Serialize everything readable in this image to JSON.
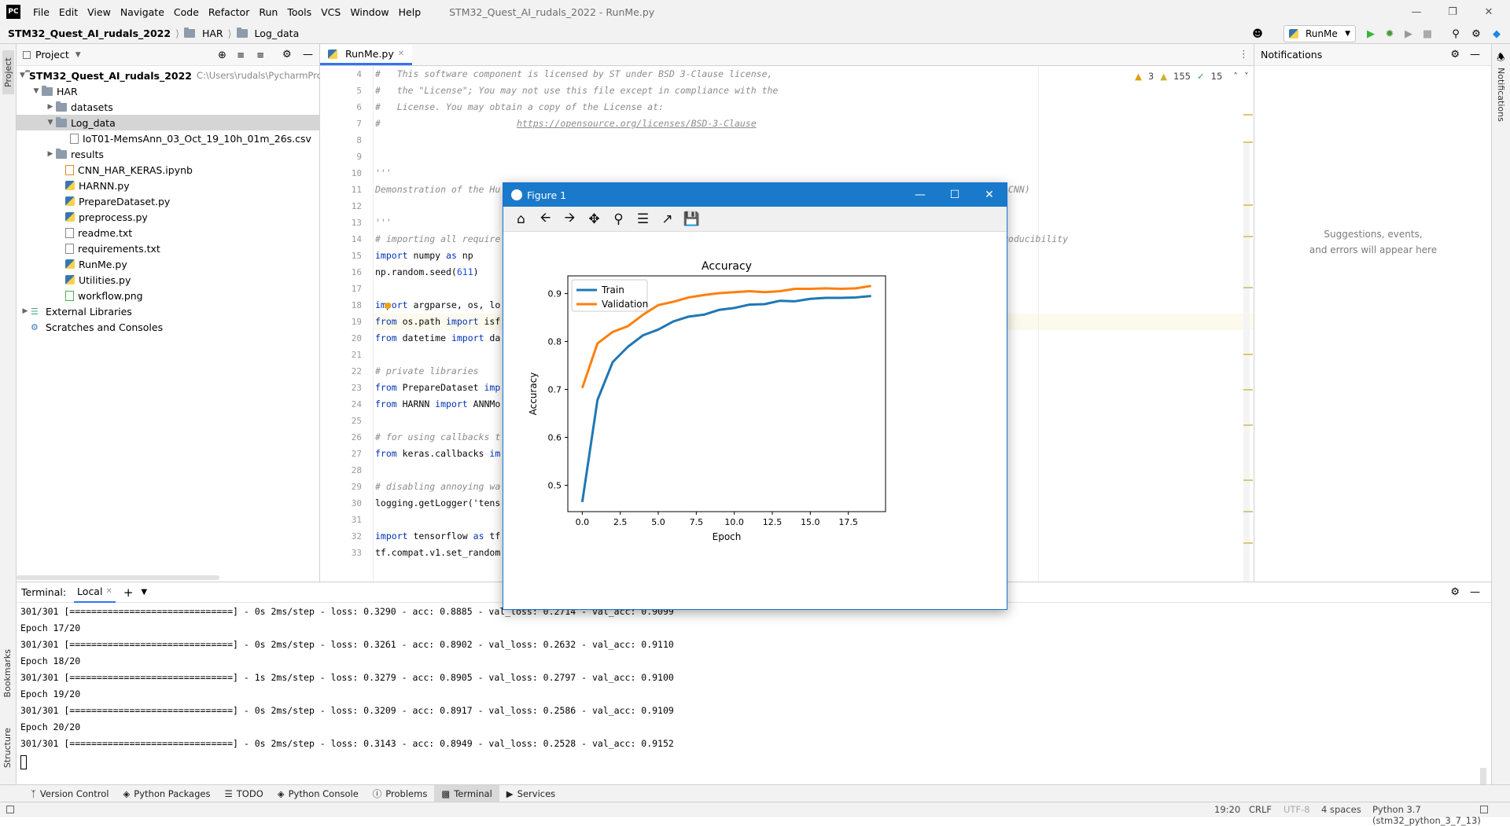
{
  "app": {
    "logo": "PC",
    "menu": [
      "File",
      "Edit",
      "View",
      "Navigate",
      "Code",
      "Refactor",
      "Run",
      "Tools",
      "VCS",
      "Window",
      "Help"
    ],
    "window_title": "STM32_Quest_AI_rudals_2022 - RunMe.py"
  },
  "breadcrumb": [
    "STM32_Quest_AI_rudals_2022",
    "HAR",
    "Log_data"
  ],
  "toolbar": {
    "run_config": "RunMe"
  },
  "project": {
    "header": "Project",
    "root_name": "STM32_Quest_AI_rudals_2022",
    "root_path": "C:\\Users\\rudals\\PycharmProj",
    "items": [
      {
        "label": "HAR"
      },
      {
        "label": "datasets"
      },
      {
        "label": "Log_data"
      },
      {
        "label": "IoT01-MemsAnn_03_Oct_19_10h_01m_26s.csv"
      },
      {
        "label": "results"
      },
      {
        "label": "CNN_HAR_KERAS.ipynb"
      },
      {
        "label": "HARNN.py"
      },
      {
        "label": "PrepareDataset.py"
      },
      {
        "label": "preprocess.py"
      },
      {
        "label": "readme.txt"
      },
      {
        "label": "requirements.txt"
      },
      {
        "label": "RunMe.py"
      },
      {
        "label": "Utilities.py"
      },
      {
        "label": "workflow.png"
      },
      {
        "label": "External Libraries"
      },
      {
        "label": "Scratches and Consoles"
      }
    ]
  },
  "editor": {
    "tab": "RunMe.py",
    "inspections": {
      "warnings": "3",
      "weak_warnings": "155",
      "typos": "15"
    },
    "line_numbers": [
      "4",
      "5",
      "6",
      "7",
      "8",
      "9",
      "10",
      "11",
      "12",
      "13",
      "14",
      "15",
      "16",
      "17",
      "18",
      "19",
      "20",
      "21",
      "22",
      "23",
      "24",
      "25",
      "26",
      "27",
      "28",
      "29",
      "30",
      "31",
      "32",
      "33"
    ],
    "code": {
      "l4": "#   This software component is licensed by ST under BSD 3-Clause license,",
      "l5": "#   the \"License\"; You may not use this file except in compliance with the",
      "l6": "#   License. You may obtain a copy of the License at:",
      "l7a": "#                         ",
      "l7b": "https://opensource.org/licenses/BSD-3-Clause",
      "l10": "'''",
      "l11a": "Demonstration of the Hu",
      "l11b": "(CNN)",
      "l13": "'''",
      "l14a": "# importing all require",
      "l14b": "roducibility",
      "l15a": "import",
      "l15b": " numpy ",
      "l15c": "as",
      "l15d": " np",
      "l16a": "np.random.seed(",
      "l16b": "611",
      "l16c": ")",
      "l18a": "import",
      "l18b": " argparse, os, lo",
      "l19a": "from",
      "l19b": " os.path ",
      "l19c": "import",
      "l19d": " isf",
      "l20a": "from",
      "l20b": " datetime ",
      "l20c": "import",
      "l20d": " da",
      "l22": "# private libraries",
      "l23a": "from",
      "l23b": " PrepareDataset ",
      "l23c": "imp",
      "l24a": "from",
      "l24b": " HARNN ",
      "l24c": "import",
      "l24d": " ANNMo",
      "l26": "# for using callbacks t",
      "l27a": "from",
      "l27b": " keras.callbacks ",
      "l27c": "im",
      "l29": "# disabling annoying wa",
      "l30": "logging.getLogger('tens",
      "l32a": "import",
      "l32b": " tensorflow ",
      "l32c": "as",
      "l32d": " tf",
      "l33": "tf.compat.v1.set_random"
    }
  },
  "notifications": {
    "header": "Notifications",
    "empty_line1": "Suggestions, events,",
    "empty_line2": "and errors will appear here"
  },
  "terminal": {
    "header": "Terminal:",
    "tab": "Local",
    "lines": [
      "301/301 [==============================] - 0s 2ms/step - loss: 0.3290 - acc: 0.8885 - val_loss: 0.2714 - val_acc: 0.9099",
      "Epoch 17/20",
      "301/301 [==============================] - 0s 2ms/step - loss: 0.3261 - acc: 0.8902 - val_loss: 0.2632 - val_acc: 0.9110",
      "Epoch 18/20",
      "301/301 [==============================] - 1s 2ms/step - loss: 0.3279 - acc: 0.8905 - val_loss: 0.2797 - val_acc: 0.9100",
      "Epoch 19/20",
      "301/301 [==============================] - 0s 2ms/step - loss: 0.3209 - acc: 0.8917 - val_loss: 0.2586 - val_acc: 0.9109",
      "Epoch 20/20",
      "301/301 [==============================] - 0s 2ms/step - loss: 0.3143 - acc: 0.8949 - val_loss: 0.2528 - val_acc: 0.9152"
    ]
  },
  "bottom_tabs": [
    "Version Control",
    "Python Packages",
    "TODO",
    "Python Console",
    "Problems",
    "Terminal",
    "Services"
  ],
  "left_tabs": {
    "project": "Project",
    "bookmarks": "Bookmarks",
    "structure": "Structure"
  },
  "right_tabs": {
    "notifications": "Notifications"
  },
  "status": {
    "position": "19:20",
    "line_sep": "CRLF",
    "encoding": "UTF-8",
    "indent": "4 spaces",
    "interpreter": "Python 3.7 (stm32_python_3_7_13)"
  },
  "figure": {
    "window_title": "Figure 1",
    "colors": {
      "train": "#1f77b4",
      "validation": "#ff7f0e"
    }
  },
  "chart_data": {
    "type": "line",
    "title": "Accuracy",
    "xlabel": "Epoch",
    "ylabel": "Accuracy",
    "xlim": [
      -0.95,
      19.95
    ],
    "ylim": [
      0.445,
      0.937
    ],
    "xticks": [
      "0.0",
      "2.5",
      "5.0",
      "7.5",
      "10.0",
      "12.5",
      "15.0",
      "17.5"
    ],
    "xtick_values": [
      0,
      2.5,
      5,
      7.5,
      10,
      12.5,
      15,
      17.5
    ],
    "yticks": [
      "0.5",
      "0.6",
      "0.7",
      "0.8",
      "0.9"
    ],
    "ytick_values": [
      0.5,
      0.6,
      0.7,
      0.8,
      0.9
    ],
    "legend_position": "top-left",
    "x": [
      0,
      1,
      2,
      3,
      4,
      5,
      6,
      7,
      8,
      9,
      10,
      11,
      12,
      13,
      14,
      15,
      16,
      17,
      18,
      19
    ],
    "series": [
      {
        "name": "Train",
        "values": [
          0.465,
          0.678,
          0.757,
          0.789,
          0.813,
          0.825,
          0.842,
          0.852,
          0.856,
          0.866,
          0.87,
          0.877,
          0.878,
          0.885,
          0.884,
          0.889,
          0.891,
          0.891,
          0.892,
          0.895
        ]
      },
      {
        "name": "Validation",
        "values": [
          0.703,
          0.796,
          0.82,
          0.832,
          0.856,
          0.876,
          0.883,
          0.892,
          0.897,
          0.901,
          0.903,
          0.905,
          0.903,
          0.905,
          0.91,
          0.91,
          0.911,
          0.91,
          0.911,
          0.916
        ]
      }
    ]
  }
}
